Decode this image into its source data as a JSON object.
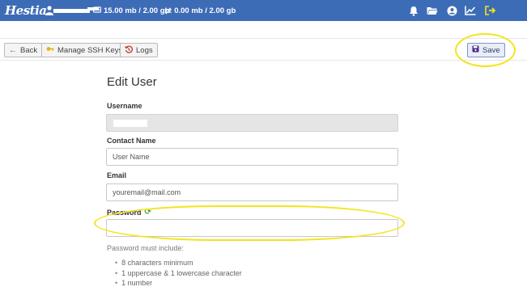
{
  "app": {
    "logo_text": "Hestia"
  },
  "topbar": {
    "disk_usage": "15.00 mb / 2.00 gb",
    "bandwidth_usage": "0.00 mb / 2.00 gb",
    "icons": [
      "bell-icon",
      "folder-icon",
      "user-circle-icon",
      "chart-line-icon",
      "logout-icon"
    ]
  },
  "toolbar": {
    "back_label": "Back",
    "ssh_keys_label": "Manage SSH Keys",
    "logs_label": "Logs",
    "save_label": "Save"
  },
  "form": {
    "title": "Edit User",
    "username_label": "Username",
    "username_value": "",
    "contact_label": "Contact Name",
    "contact_placeholder": "User Name",
    "email_label": "Email",
    "email_placeholder": "youremail@mail.com",
    "password_label": "Password",
    "password_value": "",
    "password_hint": "Password must include:",
    "password_requirements": [
      "8 characters minimum",
      "1 uppercase & 1 lowercase character",
      "1 number"
    ]
  },
  "colors": {
    "topbar": "#3d6cb7",
    "highlight": "#f2e51b",
    "save_accent": "#2e3f73",
    "refresh_green": "#3a9c3a"
  }
}
